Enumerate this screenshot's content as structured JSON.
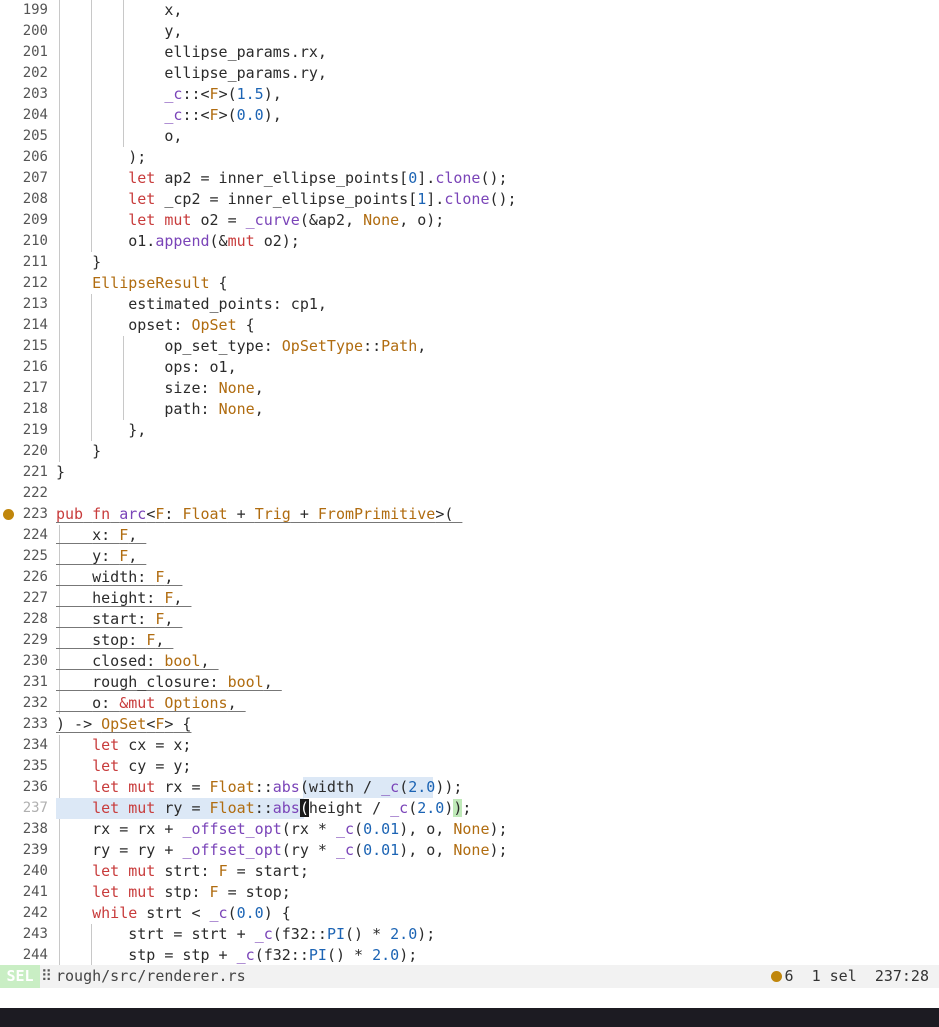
{
  "editor": {
    "lines": [
      {
        "n": "199",
        "g": 3,
        "t": [
          [
            "x,",
            "tok"
          ]
        ]
      },
      {
        "n": "200",
        "g": 3,
        "t": [
          [
            "y,",
            "tok"
          ]
        ]
      },
      {
        "n": "201",
        "g": 3,
        "t": [
          [
            "ellipse_params.rx,",
            "tok"
          ]
        ]
      },
      {
        "n": "202",
        "g": 3,
        "t": [
          [
            "ellipse_params.ry,",
            "tok"
          ]
        ]
      },
      {
        "n": "203",
        "g": 3,
        "t": [
          [
            "_c",
            "fn"
          ],
          [
            "::<",
            "tok"
          ],
          [
            "F",
            "ty"
          ],
          [
            ">(",
            "tok"
          ],
          [
            "1.5",
            "num"
          ],
          [
            "),",
            "tok"
          ]
        ]
      },
      {
        "n": "204",
        "g": 3,
        "t": [
          [
            "_c",
            "fn"
          ],
          [
            "::<",
            "tok"
          ],
          [
            "F",
            "ty"
          ],
          [
            ">(",
            "tok"
          ],
          [
            "0.0",
            "num"
          ],
          [
            "),",
            "tok"
          ]
        ]
      },
      {
        "n": "205",
        "g": 3,
        "t": [
          [
            "o,",
            "tok"
          ]
        ]
      },
      {
        "n": "206",
        "g": 2,
        "t": [
          [
            ");",
            "tok"
          ]
        ]
      },
      {
        "n": "207",
        "g": 2,
        "t": [
          [
            "let",
            "kw"
          ],
          [
            " ap2 = inner_ellipse_points[",
            "tok"
          ],
          [
            "0",
            "num"
          ],
          [
            "].",
            "tok"
          ],
          [
            "clone",
            "fn"
          ],
          [
            "();",
            "tok"
          ]
        ]
      },
      {
        "n": "208",
        "g": 2,
        "t": [
          [
            "let",
            "kw"
          ],
          [
            " _cp2 = inner_ellipse_points[",
            "tok"
          ],
          [
            "1",
            "num"
          ],
          [
            "].",
            "tok"
          ],
          [
            "clone",
            "fn"
          ],
          [
            "();",
            "tok"
          ]
        ]
      },
      {
        "n": "209",
        "g": 2,
        "t": [
          [
            "let",
            "kw"
          ],
          [
            " ",
            "tok"
          ],
          [
            "mut",
            "kw"
          ],
          [
            " o2 = ",
            "tok"
          ],
          [
            "_curve",
            "fn"
          ],
          [
            "(&ap2, ",
            "tok"
          ],
          [
            "None",
            "ty"
          ],
          [
            ", o);",
            "tok"
          ]
        ]
      },
      {
        "n": "210",
        "g": 2,
        "t": [
          [
            "o1.",
            "tok"
          ],
          [
            "append",
            "fn"
          ],
          [
            "(&",
            "tok"
          ],
          [
            "mut",
            "kw"
          ],
          [
            " o2);",
            "tok"
          ]
        ]
      },
      {
        "n": "211",
        "g": 1,
        "t": [
          [
            "}",
            "tok"
          ]
        ]
      },
      {
        "n": "212",
        "g": 1,
        "t": [
          [
            "EllipseResult",
            "ty"
          ],
          [
            " {",
            "tok"
          ]
        ]
      },
      {
        "n": "213",
        "g": 2,
        "t": [
          [
            "estimated_points: cp1,",
            "tok"
          ]
        ]
      },
      {
        "n": "214",
        "g": 2,
        "t": [
          [
            "opset: ",
            "tok"
          ],
          [
            "OpSet",
            "ty"
          ],
          [
            " {",
            "tok"
          ]
        ]
      },
      {
        "n": "215",
        "g": 3,
        "t": [
          [
            "op_set_type: ",
            "tok"
          ],
          [
            "OpSetType",
            "ty"
          ],
          [
            "::",
            "tok"
          ],
          [
            "Path",
            "ty"
          ],
          [
            ",",
            "tok"
          ]
        ]
      },
      {
        "n": "216",
        "g": 3,
        "t": [
          [
            "ops: o1,",
            "tok"
          ]
        ]
      },
      {
        "n": "217",
        "g": 3,
        "t": [
          [
            "size: ",
            "tok"
          ],
          [
            "None",
            "ty"
          ],
          [
            ",",
            "tok"
          ]
        ]
      },
      {
        "n": "218",
        "g": 3,
        "t": [
          [
            "path: ",
            "tok"
          ],
          [
            "None",
            "ty"
          ],
          [
            ",",
            "tok"
          ]
        ]
      },
      {
        "n": "219",
        "g": 2,
        "t": [
          [
            "},",
            "tok"
          ]
        ]
      },
      {
        "n": "220",
        "g": 1,
        "t": [
          [
            "}",
            "tok"
          ]
        ]
      },
      {
        "n": "221",
        "g": 0,
        "t": [
          [
            "}",
            "tok"
          ]
        ]
      },
      {
        "n": "222",
        "g": 0,
        "t": []
      },
      {
        "n": "223",
        "g": 0,
        "d": true,
        "u": true,
        "t": [
          [
            "pub",
            "kw"
          ],
          [
            " ",
            "tok"
          ],
          [
            "fn",
            "kw"
          ],
          [
            " ",
            "tok"
          ],
          [
            "arc",
            "fn"
          ],
          [
            "<",
            "tok"
          ],
          [
            "F",
            "ty"
          ],
          [
            ": ",
            "tok"
          ],
          [
            "Float",
            "ty"
          ],
          [
            " + ",
            "tok"
          ],
          [
            "Trig",
            "ty"
          ],
          [
            " + ",
            "tok"
          ],
          [
            "FromPrimitive",
            "ty"
          ],
          [
            ">( ",
            "tok"
          ]
        ]
      },
      {
        "n": "224",
        "g": 1,
        "u": true,
        "t": [
          [
            "x: ",
            "tok"
          ],
          [
            "F",
            "ty"
          ],
          [
            ", ",
            "tok"
          ]
        ]
      },
      {
        "n": "225",
        "g": 1,
        "u": true,
        "t": [
          [
            "y: ",
            "tok"
          ],
          [
            "F",
            "ty"
          ],
          [
            ", ",
            "tok"
          ]
        ]
      },
      {
        "n": "226",
        "g": 1,
        "u": true,
        "t": [
          [
            "width: ",
            "tok"
          ],
          [
            "F",
            "ty"
          ],
          [
            ", ",
            "tok"
          ]
        ]
      },
      {
        "n": "227",
        "g": 1,
        "u": true,
        "t": [
          [
            "height: ",
            "tok"
          ],
          [
            "F",
            "ty"
          ],
          [
            ", ",
            "tok"
          ]
        ]
      },
      {
        "n": "228",
        "g": 1,
        "u": true,
        "t": [
          [
            "start: ",
            "tok"
          ],
          [
            "F",
            "ty"
          ],
          [
            ", ",
            "tok"
          ]
        ]
      },
      {
        "n": "229",
        "g": 1,
        "u": true,
        "t": [
          [
            "stop: ",
            "tok"
          ],
          [
            "F",
            "ty"
          ],
          [
            ", ",
            "tok"
          ]
        ]
      },
      {
        "n": "230",
        "g": 1,
        "u": true,
        "t": [
          [
            "closed: ",
            "tok"
          ],
          [
            "bool",
            "ty"
          ],
          [
            ", ",
            "tok"
          ]
        ]
      },
      {
        "n": "231",
        "g": 1,
        "u": true,
        "t": [
          [
            "rough_closure: ",
            "tok"
          ],
          [
            "bool",
            "ty"
          ],
          [
            ", ",
            "tok"
          ]
        ]
      },
      {
        "n": "232",
        "g": 1,
        "u": true,
        "t": [
          [
            "o: ",
            "tok"
          ],
          [
            "&mut",
            "kw"
          ],
          [
            " ",
            "tok"
          ],
          [
            "Options",
            "ty"
          ],
          [
            ", ",
            "tok"
          ]
        ]
      },
      {
        "n": "233",
        "g": 0,
        "u": true,
        "t": [
          [
            ") -> ",
            "tok"
          ],
          [
            "OpSet",
            "ty"
          ],
          [
            "<",
            "tok"
          ],
          [
            "F",
            "ty"
          ],
          [
            ">",
            "tok"
          ],
          [
            " {",
            "tok"
          ]
        ]
      },
      {
        "n": "234",
        "g": 1,
        "t": [
          [
            "let",
            "kw"
          ],
          [
            " cx = x;",
            "tok"
          ]
        ]
      },
      {
        "n": "235",
        "g": 1,
        "t": [
          [
            "let",
            "kw"
          ],
          [
            " cy = y;",
            "tok"
          ]
        ]
      },
      {
        "n": "236",
        "g": 1,
        "sel": "after",
        "t": [
          [
            "let",
            "kw"
          ],
          [
            " ",
            "tok"
          ],
          [
            "mut",
            "kw"
          ],
          [
            " rx = ",
            "tok"
          ],
          [
            "Float",
            "ty"
          ],
          [
            "::",
            "tok"
          ],
          [
            "abs",
            "fn"
          ],
          [
            "(width / ",
            "tok"
          ],
          [
            "_c",
            "fn"
          ],
          [
            "(",
            "tok"
          ],
          [
            "2.0",
            "num"
          ],
          [
            "));",
            "tok"
          ]
        ]
      },
      {
        "n": "237",
        "g": 1,
        "cur": true,
        "t": [
          [
            "let",
            "kw"
          ],
          [
            " ",
            "tok"
          ],
          [
            "mut",
            "kw"
          ],
          [
            " ry = ",
            "tok"
          ],
          [
            "Float",
            "ty"
          ],
          [
            "::",
            "tok"
          ],
          [
            "abs",
            "fn"
          ],
          [
            "(",
            "cursor"
          ],
          [
            "height / ",
            "tok"
          ],
          [
            "_c",
            "fn"
          ],
          [
            "(",
            "tok"
          ],
          [
            "2.0",
            "num"
          ],
          [
            ")",
            "tok"
          ],
          [
            ")",
            "bracket-hl"
          ],
          [
            ";",
            "tok"
          ]
        ]
      },
      {
        "n": "238",
        "g": 1,
        "t": [
          [
            "rx = rx + ",
            "tok"
          ],
          [
            "_offset_opt",
            "fn"
          ],
          [
            "(rx * ",
            "tok"
          ],
          [
            "_c",
            "fn"
          ],
          [
            "(",
            "tok"
          ],
          [
            "0.01",
            "num"
          ],
          [
            "), o, ",
            "tok"
          ],
          [
            "None",
            "ty"
          ],
          [
            ");",
            "tok"
          ]
        ]
      },
      {
        "n": "239",
        "g": 1,
        "t": [
          [
            "ry = ry + ",
            "tok"
          ],
          [
            "_offset_opt",
            "fn"
          ],
          [
            "(ry * ",
            "tok"
          ],
          [
            "_c",
            "fn"
          ],
          [
            "(",
            "tok"
          ],
          [
            "0.01",
            "num"
          ],
          [
            "), o, ",
            "tok"
          ],
          [
            "None",
            "ty"
          ],
          [
            ");",
            "tok"
          ]
        ]
      },
      {
        "n": "240",
        "g": 1,
        "t": [
          [
            "let",
            "kw"
          ],
          [
            " ",
            "tok"
          ],
          [
            "mut",
            "kw"
          ],
          [
            " strt: ",
            "tok"
          ],
          [
            "F",
            "ty"
          ],
          [
            " = start;",
            "tok"
          ]
        ]
      },
      {
        "n": "241",
        "g": 1,
        "t": [
          [
            "let",
            "kw"
          ],
          [
            " ",
            "tok"
          ],
          [
            "mut",
            "kw"
          ],
          [
            " stp: ",
            "tok"
          ],
          [
            "F",
            "ty"
          ],
          [
            " = stop;",
            "tok"
          ]
        ]
      },
      {
        "n": "242",
        "g": 1,
        "t": [
          [
            "while",
            "kw"
          ],
          [
            " strt < ",
            "tok"
          ],
          [
            "_c",
            "fn"
          ],
          [
            "(",
            "tok"
          ],
          [
            "0.0",
            "num"
          ],
          [
            ") {",
            "tok"
          ]
        ]
      },
      {
        "n": "243",
        "g": 2,
        "t": [
          [
            "strt = strt + ",
            "tok"
          ],
          [
            "_c",
            "fn"
          ],
          [
            "(f32::",
            "tok"
          ],
          [
            "PI",
            "num"
          ],
          [
            "() * ",
            "tok"
          ],
          [
            "2.0",
            "num"
          ],
          [
            ");",
            "tok"
          ]
        ]
      },
      {
        "n": "244",
        "g": 2,
        "t": [
          [
            "stp = stp + ",
            "tok"
          ],
          [
            "_c",
            "fn"
          ],
          [
            "(f32::",
            "tok"
          ],
          [
            "PI",
            "num"
          ],
          [
            "() * ",
            "tok"
          ],
          [
            "2.0",
            "num"
          ],
          [
            ");",
            "tok"
          ]
        ]
      }
    ]
  },
  "statusbar": {
    "mode": "SEL",
    "separator": "⠿",
    "file_path": "rough/src/renderer.rs",
    "diagnostics_count": "6",
    "selections": "1 sel",
    "position": "237:28"
  },
  "colors": {
    "keyword": "#c83c3c",
    "type": "#b06c10",
    "function": "#7a44b8",
    "number": "#1c64b4",
    "selection": "#dce8f6",
    "mode_bg": "#c9eec4",
    "diagnostic": "#c0860b"
  }
}
